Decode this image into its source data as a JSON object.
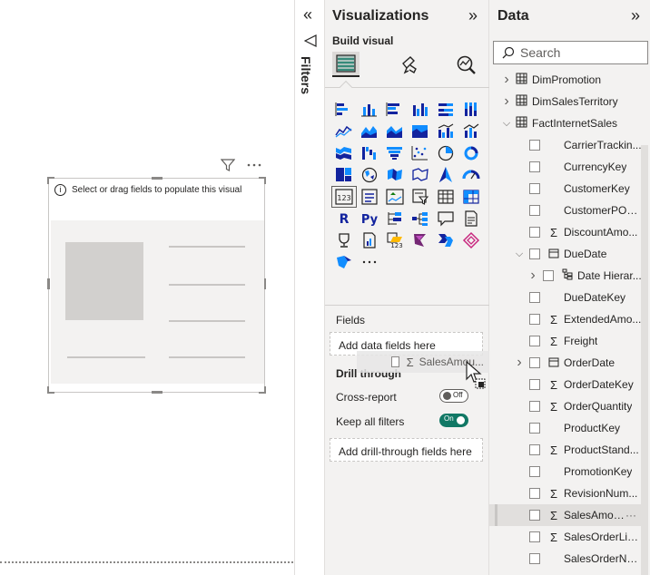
{
  "canvas": {
    "visual_message": "Select or drag fields to populate this visual"
  },
  "filters": {
    "label": "Filters"
  },
  "visualizations": {
    "title": "Visualizations",
    "build_label": "Build visual",
    "fields_label": "Fields",
    "fields_well": "Add data fields here",
    "drill_label": "Drill through",
    "cross_report": "Cross-report",
    "cross_report_state": "Off",
    "keep_filters": "Keep all filters",
    "keep_filters_state": "On",
    "drill_well": "Add drill-through fields here",
    "more_label": "···"
  },
  "drag": {
    "field": "SalesAmou...",
    "more": "···"
  },
  "data_pane": {
    "title": "Data",
    "search_placeholder": "Search",
    "items": [
      {
        "name": "DimPromotion",
        "type": "table",
        "level": 0,
        "expand": "collapsed"
      },
      {
        "name": "DimSalesTerritory",
        "type": "table",
        "level": 0,
        "expand": "collapsed"
      },
      {
        "name": "FactInternetSales",
        "type": "table",
        "level": 0,
        "expand": "expanded"
      },
      {
        "name": "CarrierTrackin...",
        "type": "field",
        "level": 1,
        "icon": "none"
      },
      {
        "name": "CurrencyKey",
        "type": "field",
        "level": 1,
        "icon": "none"
      },
      {
        "name": "CustomerKey",
        "type": "field",
        "level": 1,
        "icon": "none"
      },
      {
        "name": "CustomerPON...",
        "type": "field",
        "level": 1,
        "icon": "none"
      },
      {
        "name": "DiscountAmo...",
        "type": "field",
        "level": 1,
        "icon": "sigma"
      },
      {
        "name": "DueDate",
        "type": "field",
        "level": 1,
        "icon": "calendar",
        "expand": "expanded"
      },
      {
        "name": "Date Hierar...",
        "type": "field",
        "level": 2,
        "icon": "hierarchy",
        "expand": "collapsed"
      },
      {
        "name": "DueDateKey",
        "type": "field",
        "level": 1,
        "icon": "none"
      },
      {
        "name": "ExtendedAmo...",
        "type": "field",
        "level": 1,
        "icon": "sigma"
      },
      {
        "name": "Freight",
        "type": "field",
        "level": 1,
        "icon": "sigma"
      },
      {
        "name": "OrderDate",
        "type": "field",
        "level": 1,
        "icon": "calendar",
        "expand": "collapsed"
      },
      {
        "name": "OrderDateKey",
        "type": "field",
        "level": 1,
        "icon": "sigma"
      },
      {
        "name": "OrderQuantity",
        "type": "field",
        "level": 1,
        "icon": "sigma"
      },
      {
        "name": "ProductKey",
        "type": "field",
        "level": 1,
        "icon": "none"
      },
      {
        "name": "ProductStand...",
        "type": "field",
        "level": 1,
        "icon": "sigma"
      },
      {
        "name": "PromotionKey",
        "type": "field",
        "level": 1,
        "icon": "none"
      },
      {
        "name": "RevisionNum...",
        "type": "field",
        "level": 1,
        "icon": "sigma"
      },
      {
        "name": "SalesAmou...",
        "type": "field",
        "level": 1,
        "icon": "sigma",
        "highlighted": true
      },
      {
        "name": "SalesOrderLin...",
        "type": "field",
        "level": 1,
        "icon": "sigma"
      },
      {
        "name": "SalesOrderNu...",
        "type": "field",
        "level": 1,
        "icon": "none"
      }
    ]
  },
  "colors": {
    "accent_toggle_on": "#117865",
    "pane_bg": "#f3f2f1",
    "viz_blue": "#118dff",
    "viz_dark": "#12239e"
  },
  "viz_icons": [
    "stacked-bar-icon",
    "stacked-column-icon",
    "clustered-bar-icon",
    "clustered-column-icon",
    "100-stacked-bar-icon",
    "100-stacked-column-icon",
    "line-chart-icon",
    "area-chart-icon",
    "stacked-area-icon",
    "100-stacked-area-icon",
    "line-clustered-column-icon",
    "line-stacked-column-icon",
    "ribbon-chart-icon",
    "waterfall-icon",
    "funnel-icon",
    "scatter-icon",
    "pie-chart-icon",
    "donut-chart-icon",
    "treemap-icon",
    "map-icon",
    "filled-map-icon",
    "shape-map-icon",
    "azure-map-icon",
    "gauge-icon",
    "card-icon",
    "multi-row-card-icon",
    "kpi-icon",
    "slicer-icon",
    "table-icon",
    "matrix-icon",
    "r-visual-icon",
    "python-visual-icon",
    "key-influencers-icon",
    "decomposition-tree-icon",
    "qna-icon",
    "smart-narrative-icon",
    "goals-icon",
    "paginated-report-icon",
    "card-new-icon",
    "power-apps-icon",
    "power-automate-icon",
    "diamond-visual-icon",
    "arcgis-icon",
    "more-visuals-icon"
  ]
}
